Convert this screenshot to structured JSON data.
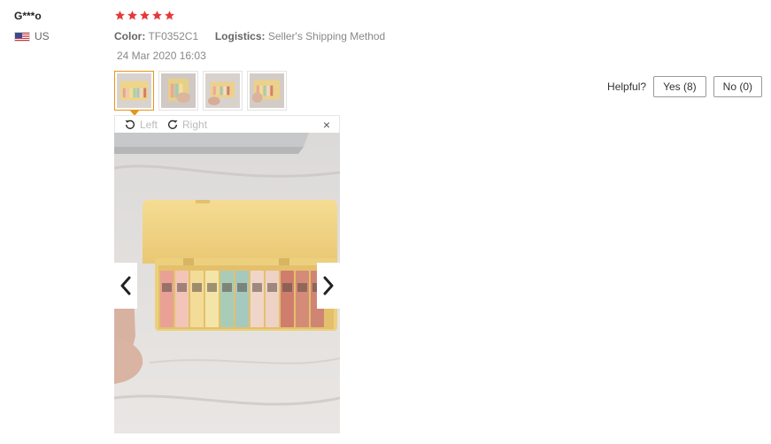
{
  "review": {
    "user_name": "G***o",
    "country": "US",
    "rating": 5,
    "color_label": "Color:",
    "color_value": "TF0352C1",
    "logistics_label": "Logistics:",
    "logistics_value": "Seller's Shipping Method",
    "date": "24 Mar 2020 16:03"
  },
  "helpful": {
    "label": "Helpful?",
    "yes_label": "Yes (8)",
    "no_label": "No (0)"
  },
  "viewer": {
    "rotate_left_label": "Left",
    "rotate_right_label": "Right",
    "close_glyph": "×"
  },
  "colors": {
    "star": "#e4393c",
    "active_thumb_border": "#e8941d",
    "case_yellow": "#f3d98a",
    "sheet": "#e7e4e3"
  }
}
